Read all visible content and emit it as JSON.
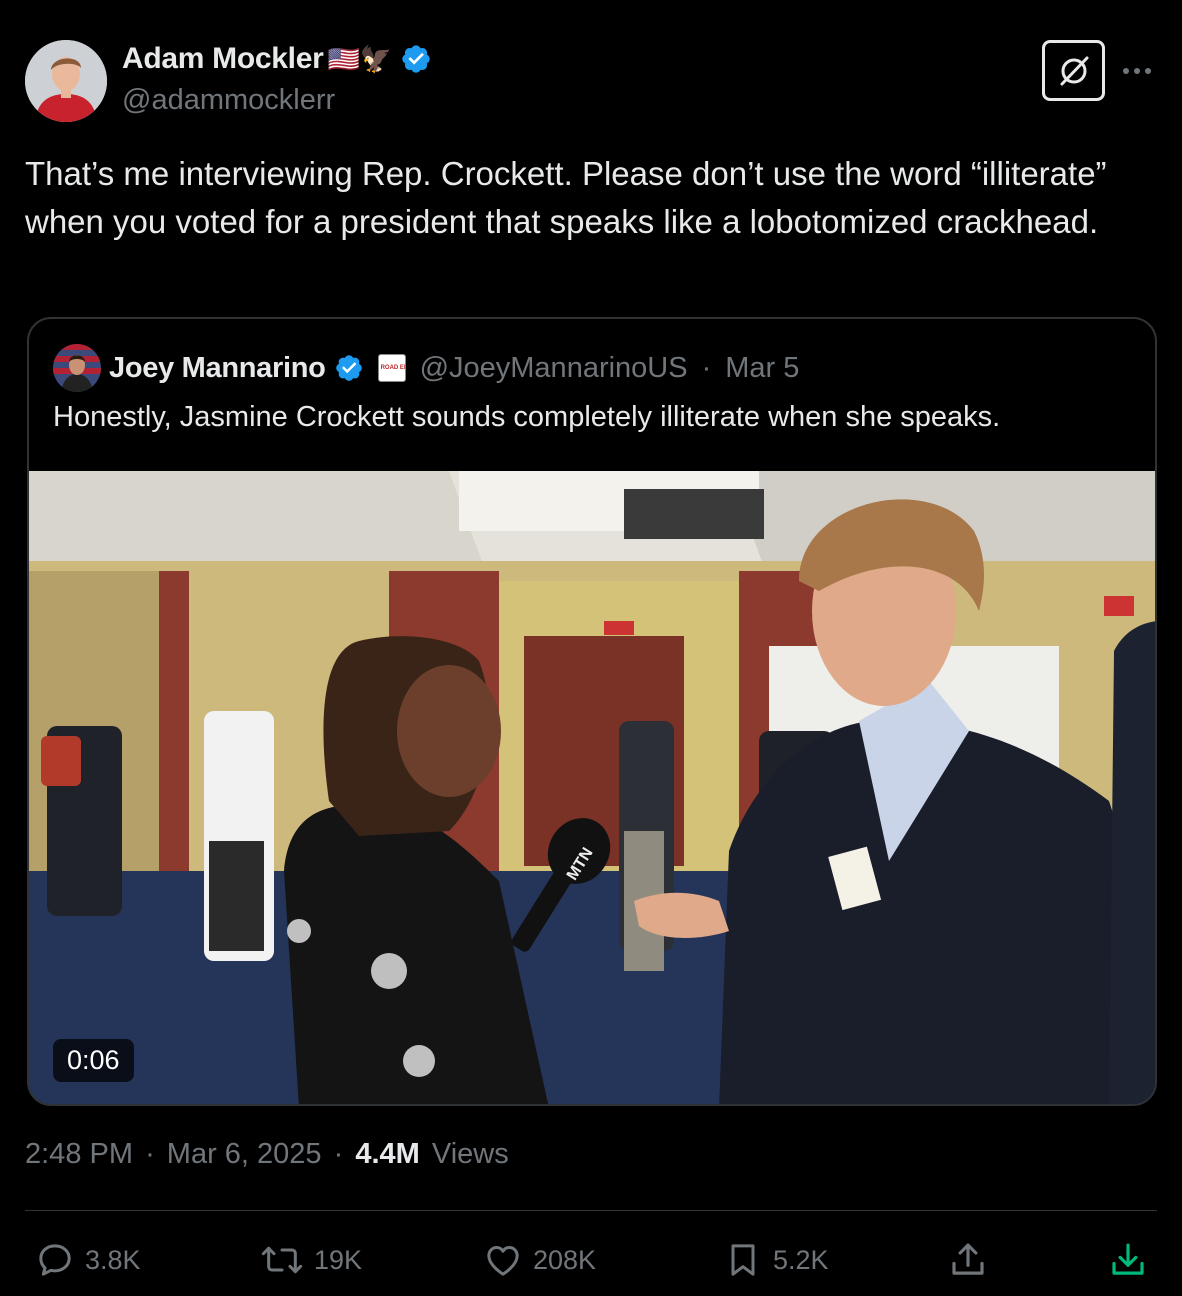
{
  "author": {
    "name": "Adam Mockler",
    "emoji": "🇺🇸🦅",
    "handle": "@adammocklerr",
    "verified": true
  },
  "tweet": {
    "text": "That’s me interviewing Rep. Crockett. Please don’t use the word “illiterate” when you voted for a president that speaks like a lobotomized crackhead."
  },
  "quoted": {
    "name": "Joey Mannarino",
    "handle": "@JoeyMannarinoUS",
    "separator": "·",
    "date": "Mar 5",
    "badge_text": "ROAD ELECTION",
    "text": "Honestly, Jasmine Crockett sounds completely illiterate when she speaks.",
    "video_duration": "0:06",
    "mic_label": "MTN"
  },
  "meta": {
    "time": "2:48 PM",
    "sep1": "·",
    "date": "Mar 6, 2025",
    "sep2": "·",
    "views_count": "4.4M",
    "views_label": "Views"
  },
  "actions": {
    "replies": "3.8K",
    "reposts": "19K",
    "likes": "208K",
    "bookmarks": "5.2K"
  },
  "colors": {
    "background": "#000000",
    "text": "#e7e9ea",
    "muted": "#71767b",
    "border": "#2f3336",
    "verified": "#1d9bf0",
    "download": "#00ba7c"
  },
  "icons": {
    "verified": "verified-badge-icon",
    "grok": "grok-icon",
    "more": "more-icon",
    "reply": "reply-icon",
    "repost": "repost-icon",
    "like": "like-icon",
    "bookmark": "bookmark-icon",
    "share": "share-icon",
    "download": "download-icon"
  }
}
